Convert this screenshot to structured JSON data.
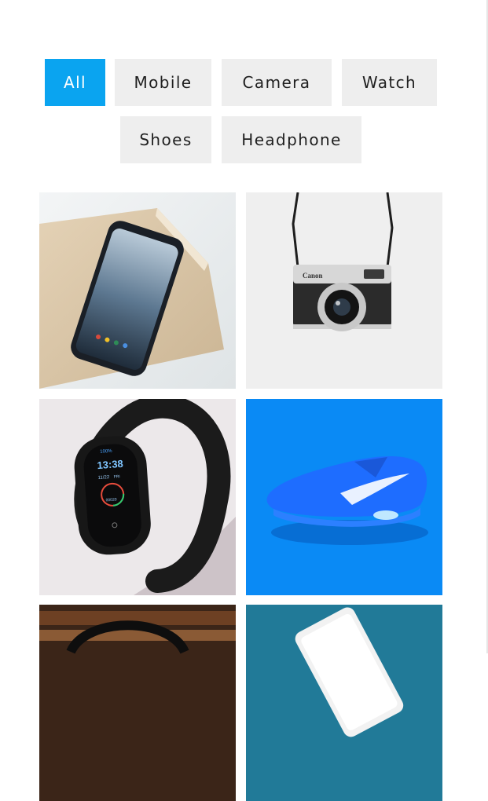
{
  "filters": {
    "items": [
      {
        "label": "All",
        "active": true
      },
      {
        "label": "Mobile",
        "active": false
      },
      {
        "label": "Camera",
        "active": false
      },
      {
        "label": "Watch",
        "active": false
      },
      {
        "label": "Shoes",
        "active": false
      },
      {
        "label": "Headphone",
        "active": false
      }
    ]
  },
  "camera": {
    "brand": "Canon"
  },
  "watch": {
    "battery": "100%",
    "time": "13:38",
    "date": "11/22",
    "day": "FRI",
    "steps": "00020"
  },
  "colors": {
    "accent": "#0aa4f0",
    "filter_bg": "#eeeeee",
    "shoe_bg": "#0a8af5"
  }
}
